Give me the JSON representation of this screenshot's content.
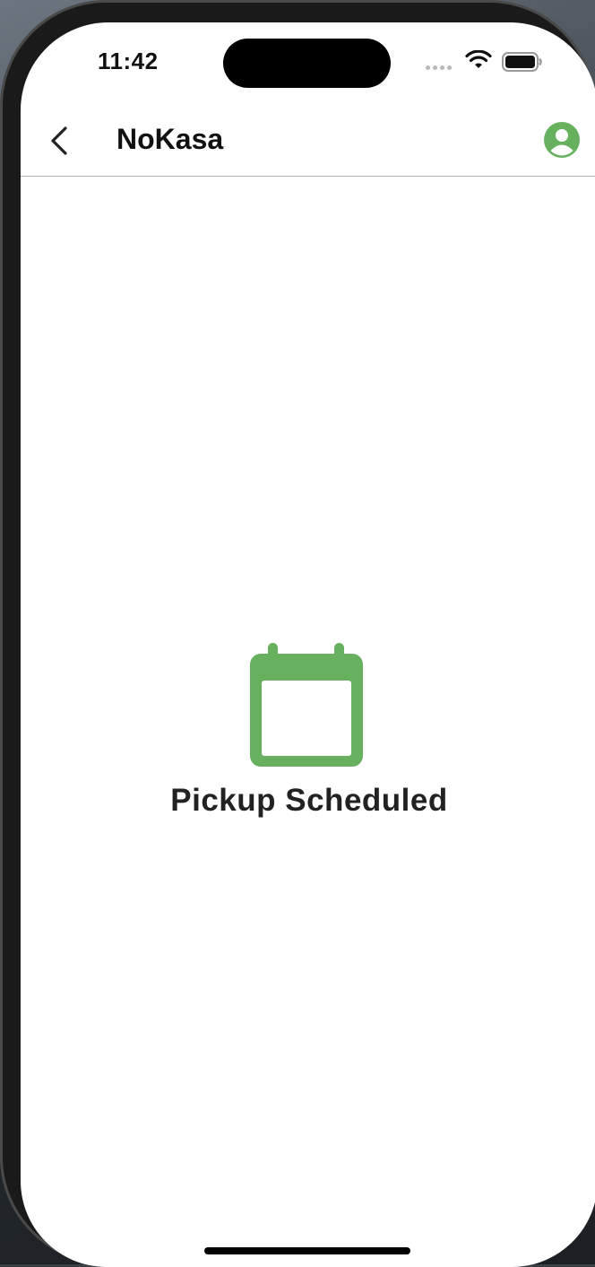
{
  "status_bar": {
    "time": "11:42",
    "icons": [
      "cellular-signal-icon",
      "wifi-icon",
      "battery-icon"
    ]
  },
  "nav": {
    "back_icon": "chevron-left-icon",
    "title": "NoKasa",
    "profile_icon": "user-circle-icon"
  },
  "main": {
    "icon": "calendar-icon",
    "message": "Pickup Scheduled"
  },
  "colors": {
    "accent_green": "#66B05E",
    "text_dark": "#111111",
    "divider": "#B0B0B0"
  }
}
